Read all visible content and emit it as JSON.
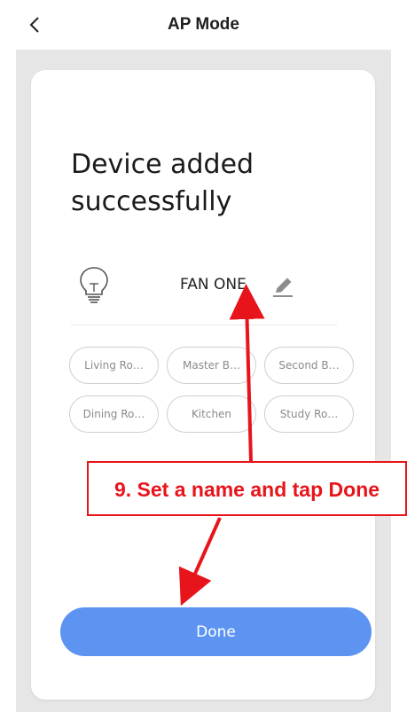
{
  "header": {
    "title": "AP Mode",
    "back_icon": "chevron-left-icon"
  },
  "card": {
    "headline": "Device added successfully",
    "device": {
      "icon": "lightbulb-icon",
      "name": "FAN ONE",
      "edit_icon": "pencil-icon"
    },
    "rooms": [
      "Living Ro…",
      "Master B…",
      "Second B…",
      "Dining Ro…",
      "Kitchen",
      "Study Ro…"
    ],
    "done_label": "Done"
  },
  "annotation": {
    "text": "9. Set a name and tap Done",
    "color": "#e8141b"
  },
  "colors": {
    "accent": "#5d94f2",
    "background": "#e6e6e6",
    "card": "#ffffff"
  }
}
